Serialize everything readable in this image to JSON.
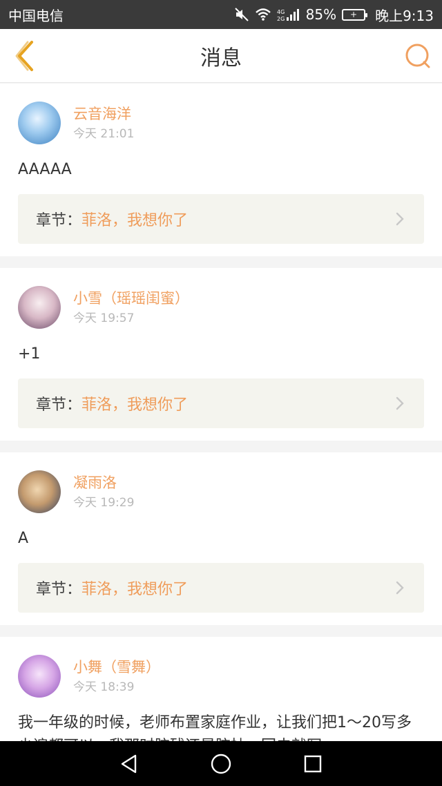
{
  "status_bar": {
    "carrier": "中国电信",
    "battery_percent": "85%",
    "time": "晚上9:13",
    "network": "4G 2G"
  },
  "header": {
    "title": "消息"
  },
  "chapter_label": "章节：",
  "messages": [
    {
      "username": "云音海洋",
      "time": "今天 21:01",
      "content": "AAAAA",
      "chapter": "菲洛，我想你了",
      "avatar_colors": [
        "#b9d8f0",
        "#3a7fc0"
      ]
    },
    {
      "username": "小雪（瑶瑶闺蜜）",
      "time": "今天 19:57",
      "content": "+1",
      "chapter": "菲洛，我想你了",
      "avatar_colors": [
        "#f3e6ea",
        "#6b4a68"
      ]
    },
    {
      "username": "凝雨洛",
      "time": "今天 19:29",
      "content": "A",
      "chapter": "菲洛，我想你了",
      "avatar_colors": [
        "#d9b48a",
        "#2f3e5e"
      ]
    },
    {
      "username": "小舞（雪舞）",
      "time": "今天 18:39",
      "content": "我一年级的时候，老师布置家庭作业，让我们把1～20写多少遍都可以，我那时脑残还是脑抽，回去就写",
      "avatar_colors": [
        "#e9c7ef",
        "#8a4fb8"
      ]
    }
  ],
  "colors": {
    "accent": "#f0a060",
    "status_bar": "#3a3a3a",
    "back_icon": "#e6a321"
  }
}
